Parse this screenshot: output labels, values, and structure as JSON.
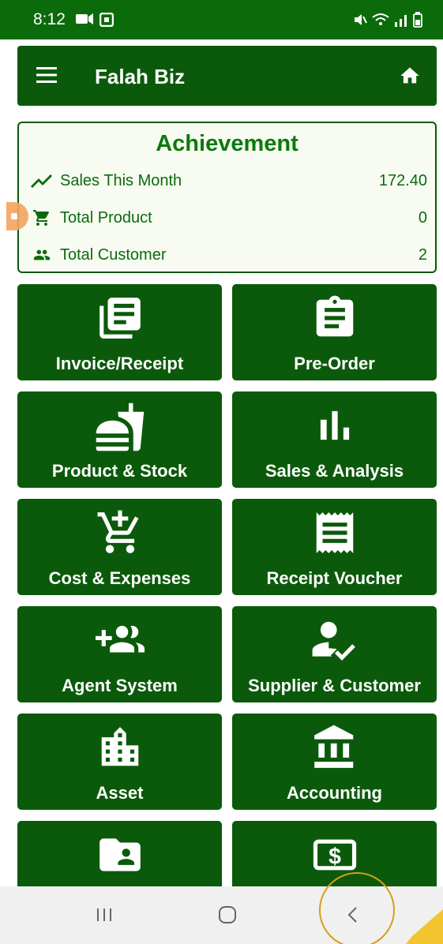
{
  "status_bar": {
    "time": "8:12"
  },
  "app_bar": {
    "title": "Falah Biz",
    "menu_icon": "hamburger-menu-icon",
    "home_icon": "home-icon"
  },
  "achievement": {
    "title": "Achievement",
    "stats": [
      {
        "icon": "trending-up-icon",
        "label": "Sales This Month",
        "value": "172.40"
      },
      {
        "icon": "cart-icon",
        "label": "Total Product",
        "value": "0"
      },
      {
        "icon": "people-icon",
        "label": "Total Customer",
        "value": "2"
      }
    ]
  },
  "tiles": [
    {
      "icon": "document-list-icon",
      "label": "Invoice/Receipt"
    },
    {
      "icon": "clipboard-icon",
      "label": "Pre-Order"
    },
    {
      "icon": "fastfood-icon",
      "label": "Product & Stock"
    },
    {
      "icon": "bar-chart-icon",
      "label": "Sales & Analysis"
    },
    {
      "icon": "add-cart-icon",
      "label": "Cost & Expenses"
    },
    {
      "icon": "receipt-icon",
      "label": "Receipt Voucher"
    },
    {
      "icon": "group-add-icon",
      "label": "Agent System"
    },
    {
      "icon": "person-check-icon",
      "label": "Supplier & Customer"
    },
    {
      "icon": "building-icon",
      "label": "Asset"
    },
    {
      "icon": "bank-icon",
      "label": "Accounting"
    },
    {
      "icon": "folder-shared-icon",
      "label": ""
    },
    {
      "icon": "dollar-icon",
      "label": ""
    }
  ],
  "colors": {
    "primary": "#0b5a0b",
    "status_bar": "#0b6b0b",
    "achievement_bg": "#f7fbf2",
    "accent_text": "#0b7a0b"
  }
}
